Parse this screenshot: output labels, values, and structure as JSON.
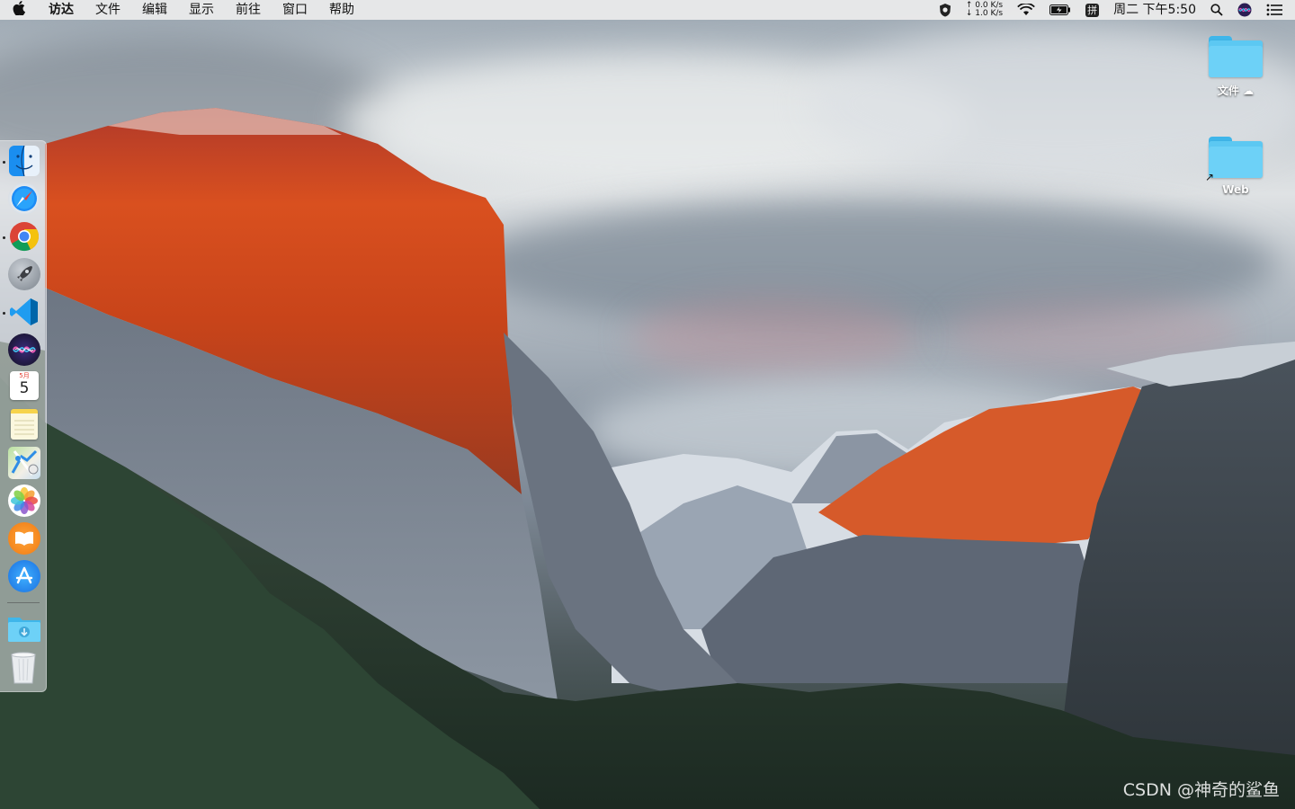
{
  "menubar": {
    "apple_icon": "apple-logo-icon",
    "menus": [
      "访达",
      "文件",
      "编辑",
      "显示",
      "前往",
      "窗口",
      "帮助"
    ],
    "status": {
      "net_up": "↑ 0.0 K/s",
      "net_down": "↓ 1.0 K/s",
      "input_method": "拼",
      "clock": "周二 下午5:50"
    }
  },
  "dock": {
    "apps": [
      "Finder",
      "Safari",
      "Google Chrome",
      "Launchpad",
      "Visual Studio Code",
      "Siri",
      "Calendar",
      "Notes",
      "Maps",
      "Photos",
      "Books",
      "App Store",
      "Downloads",
      "Trash"
    ],
    "calendar_month": "5月",
    "calendar_day": "5"
  },
  "desktop": {
    "icons": [
      {
        "label": "文件",
        "cloud": "☁"
      },
      {
        "label": "Web"
      }
    ],
    "watermark": "CSDN @神奇的鲨鱼"
  },
  "colors": {
    "folder_blue": "#5cc8f2",
    "menubar_bg": "#ececec",
    "cliff_orange": "#d9501f"
  }
}
